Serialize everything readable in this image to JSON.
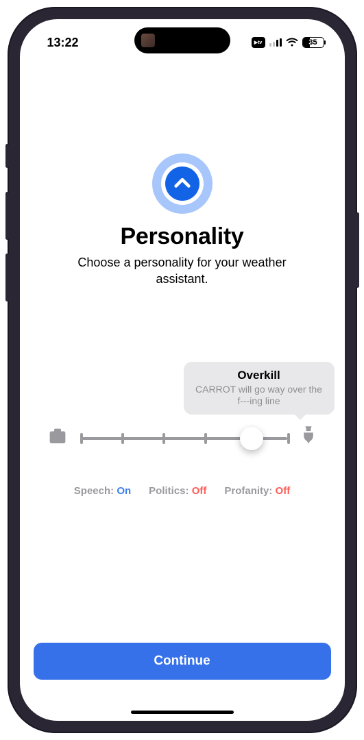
{
  "status_bar": {
    "time": "13:22",
    "battery_percent": 35,
    "battery_text": "35"
  },
  "header": {
    "title": "Personality",
    "subtitle": "Choose a personality for your weather assistant."
  },
  "slider": {
    "tooltip_title": "Overkill",
    "tooltip_subtitle": "CARROT will go way over the f---ing line",
    "position_percent": 83,
    "ticks": 5
  },
  "toggles": {
    "speech": {
      "label": "Speech:",
      "value": "On",
      "state": "on"
    },
    "politics": {
      "label": "Politics:",
      "value": "Off",
      "state": "off"
    },
    "profanity": {
      "label": "Profanity:",
      "value": "Off",
      "state": "off"
    }
  },
  "footer": {
    "continue_label": "Continue"
  }
}
